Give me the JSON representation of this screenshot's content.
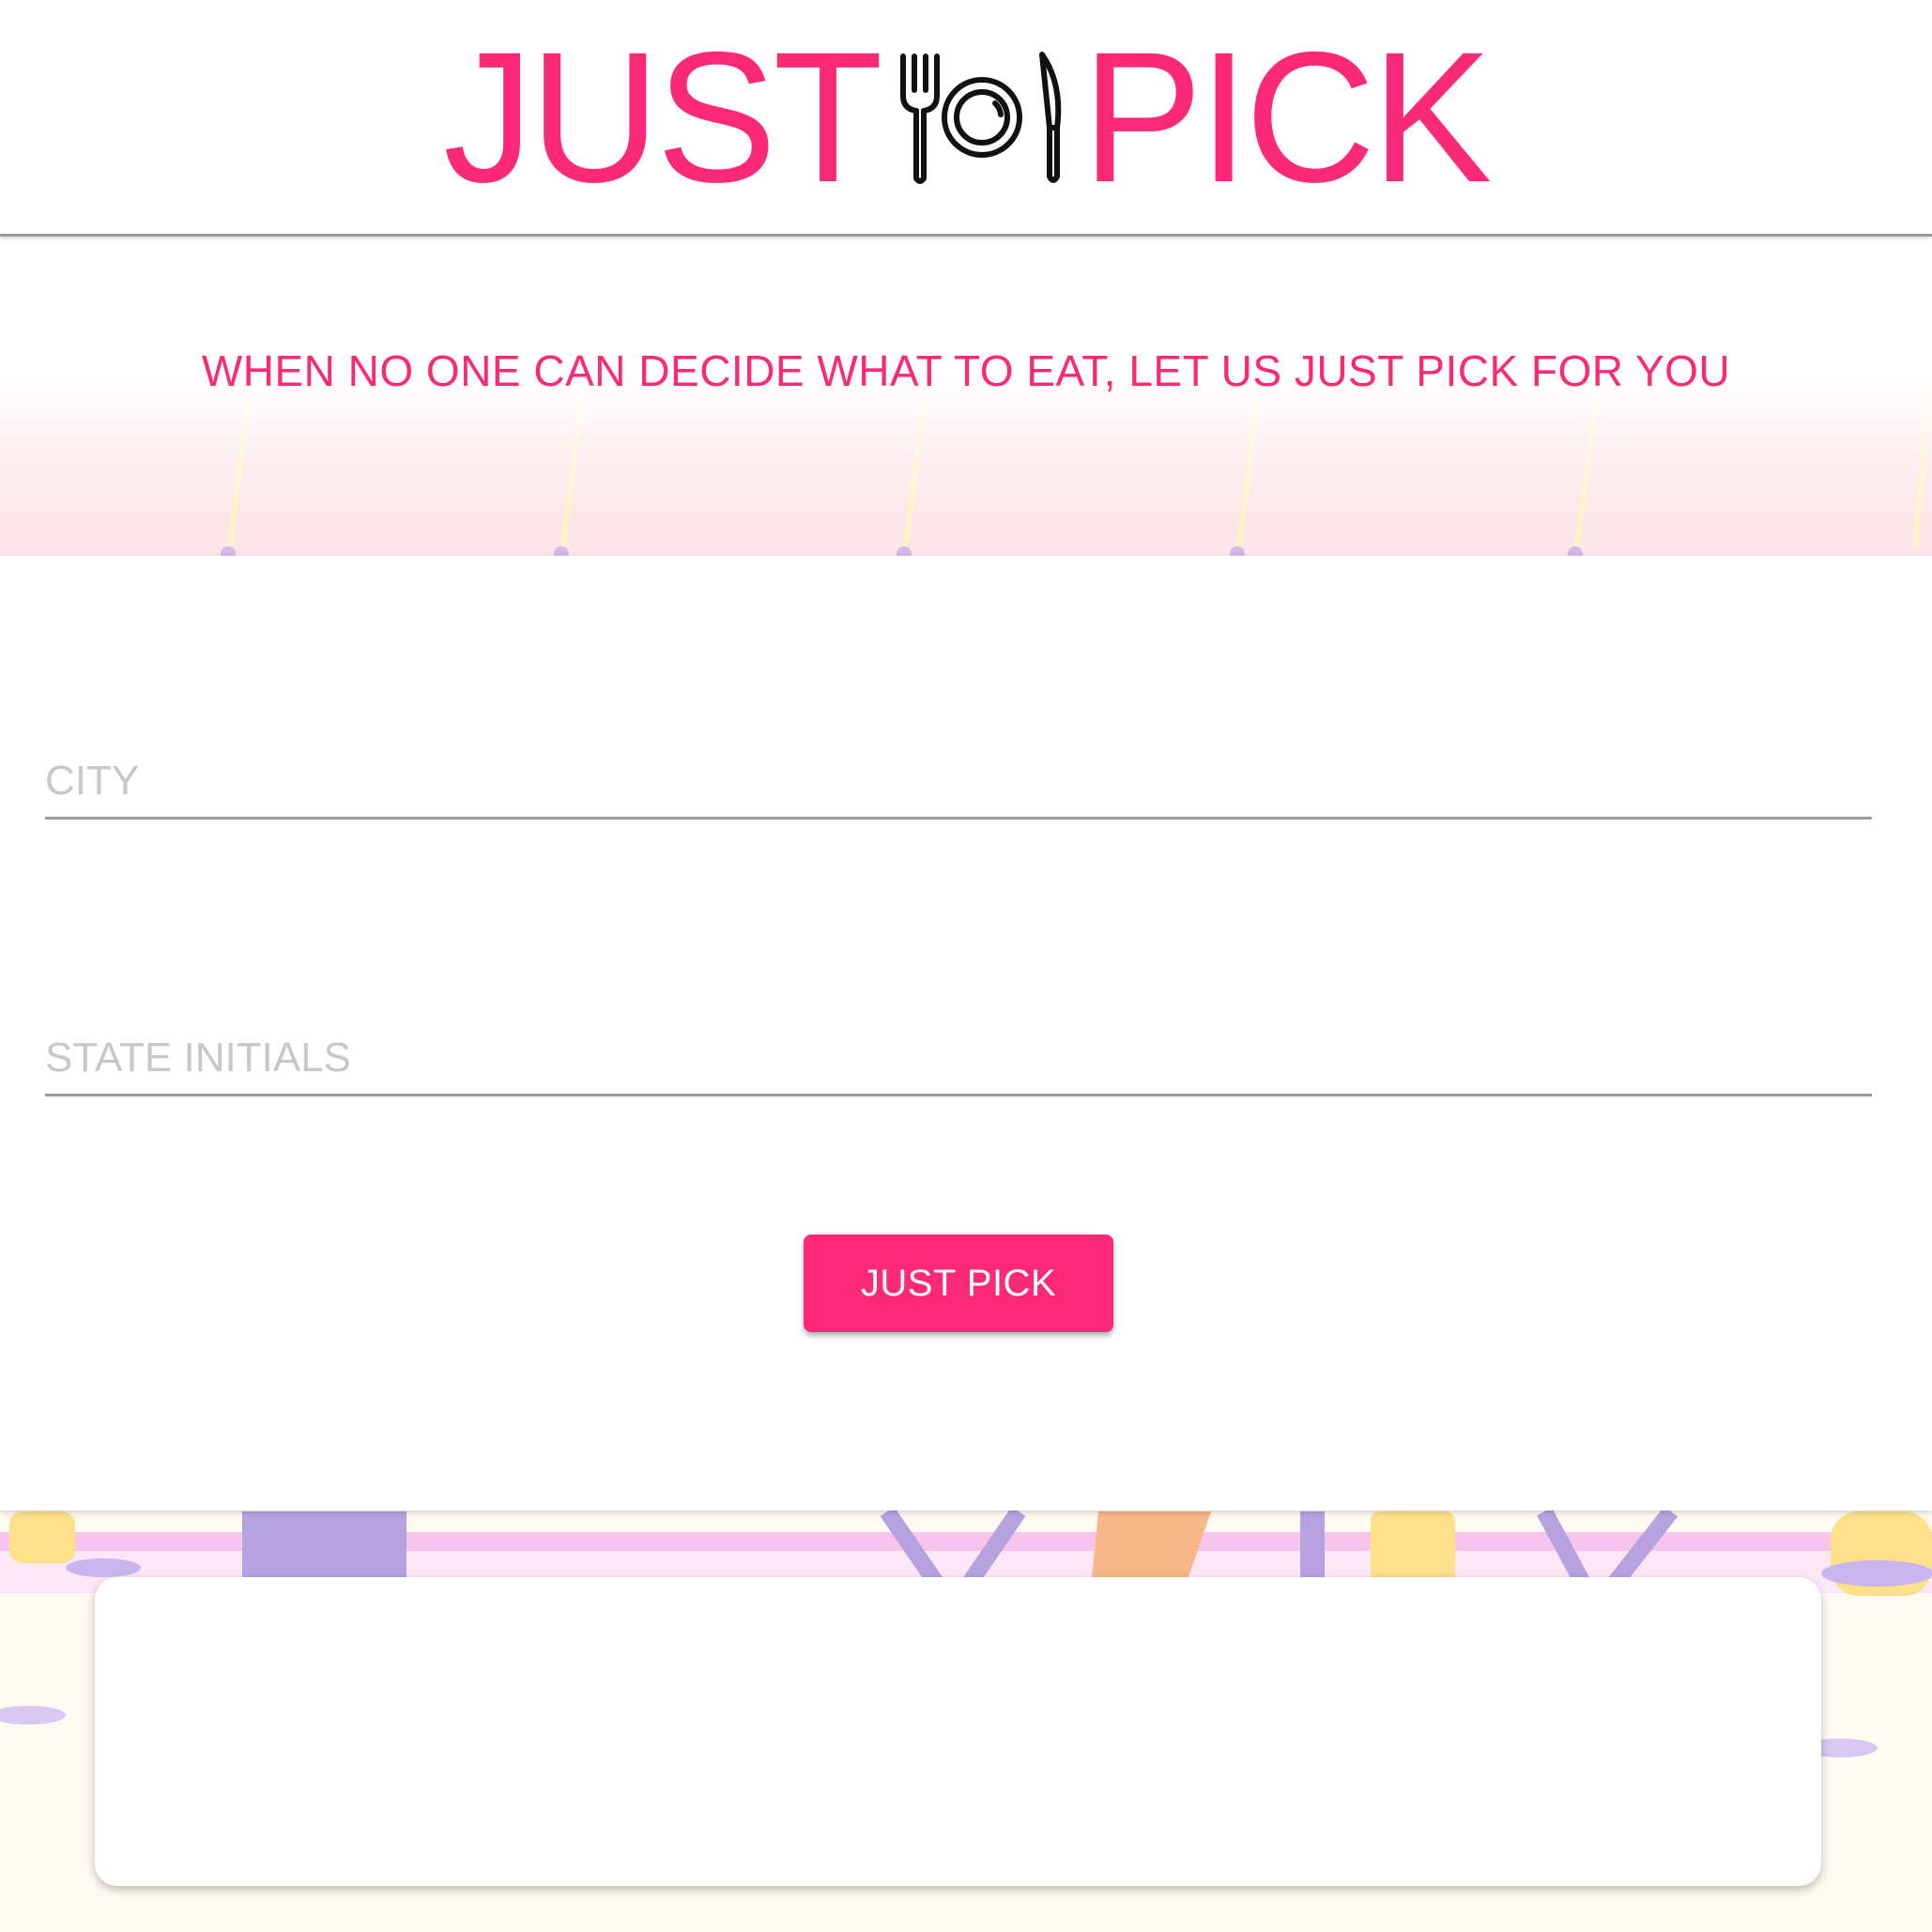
{
  "brand": {
    "logo_left": "JUST",
    "logo_right": "PICK",
    "logo_icon": "plate-fork-knife-icon",
    "accent_color": "#fc2a76"
  },
  "tagline": "WHEN NO ONE CAN DECIDE WHAT TO EAT, LET US JUST PICK FOR YOU",
  "form": {
    "city": {
      "placeholder": "CITY",
      "value": ""
    },
    "state": {
      "placeholder": "STATE INITIALS",
      "value": ""
    },
    "submit_label": "JUST PICK"
  },
  "results": {
    "text": ""
  }
}
